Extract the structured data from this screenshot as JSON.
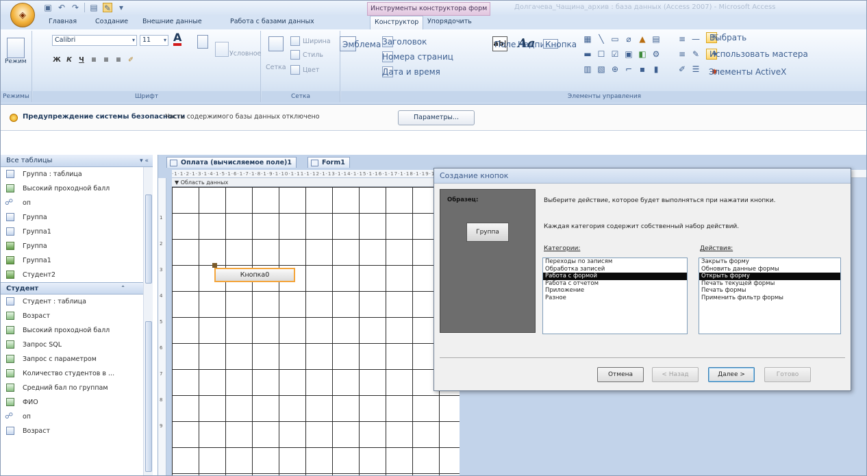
{
  "app": {
    "office_button": "",
    "context_title": "Инструменты конструктора форм",
    "window_title": "Долгачева_Чащина_архив : база данных (Access 2007) - Microsoft Access"
  },
  "ribbon_tabs": {
    "home": "Главная",
    "create": "Создание",
    "external": "Внешние данные",
    "db_tools": "Работа с базами данных",
    "design": "Конструктор",
    "arrange": "Упорядочить"
  },
  "ribbon": {
    "groups": {
      "views": "Режимы",
      "font": "Шрифт",
      "grid": "Сетка",
      "controls": "Элементы управления"
    },
    "views_btn": "Режим",
    "font_name": "Calibri",
    "font_size": "11",
    "conditional": "Условное",
    "gridlines": "Сетка",
    "width": "Ширина",
    "style": "Стиль",
    "color": "Цвет",
    "logo": "Эмблема",
    "title": "Заголовок",
    "page_numbers": "Номера страниц",
    "date_time": "Дата и время",
    "field": "Поле",
    "label": "Надпись",
    "button": "Кнопка",
    "select": "Выбрать",
    "use_wizards": "Использовать мастера",
    "activex": "Элементы ActiveX"
  },
  "security": {
    "title": "Предупреждение системы безопасности",
    "message": "Часть содержимого базы данных отключено",
    "options_button": "Параметры..."
  },
  "nav": {
    "header": "Все таблицы",
    "items_top": [
      {
        "label": "Группа : таблица",
        "type": "table"
      },
      {
        "label": "Высокий проходной балл",
        "type": "query"
      },
      {
        "label": "оп",
        "type": "key"
      },
      {
        "label": "Группа",
        "type": "table"
      },
      {
        "label": "Группа1",
        "type": "table"
      },
      {
        "label": "Группа",
        "type": "form"
      },
      {
        "label": "Группа1",
        "type": "form"
      },
      {
        "label": "Студент2",
        "type": "form"
      }
    ],
    "group2": "Студент",
    "items_bottom": [
      {
        "label": "Студент : таблица",
        "type": "table"
      },
      {
        "label": "Возраст",
        "type": "query"
      },
      {
        "label": "Высокий проходной балл",
        "type": "query"
      },
      {
        "label": "Запрос SQL",
        "type": "query"
      },
      {
        "label": "Запрос с параметром",
        "type": "query"
      },
      {
        "label": "Количество студентов в ...",
        "type": "query"
      },
      {
        "label": "Средний бал по группам",
        "type": "query"
      },
      {
        "label": "ФИО",
        "type": "query"
      },
      {
        "label": "оп",
        "type": "key"
      },
      {
        "label": "Возраст",
        "type": "table"
      }
    ]
  },
  "doc_tabs": {
    "tab1": "Оплата (вычисляемое поле)1",
    "tab2": "Form1"
  },
  "designer": {
    "ruler": "·1·1·2·1·3·1·4·1·5·1·6·1·7·1·8·1·9·1·10·1·11·1·12·1·13·1·14·1·15·1·16·1·17·1·18·1·19·1",
    "section": "Область данных",
    "button_control": "Кнопка0",
    "vruler": [
      "1",
      "2",
      "3",
      "4",
      "5",
      "6",
      "7",
      "8",
      "9"
    ]
  },
  "dialog": {
    "title": "Создание кнопок",
    "sample_label": "Образец:",
    "sample_button": "Группа",
    "instruction": "Выберите действие, которое будет выполняться при нажатии кнопки.",
    "category_note": "Каждая категория содержит собственный набор действий.",
    "categories_label": "Категории:",
    "actions_label": "Действия:",
    "categories": [
      "Переходы по записям",
      "Обработка записей",
      "Работа с формой",
      "Работа с отчетом",
      "Приложение",
      "Разное"
    ],
    "actions": [
      "Закрыть форму",
      "Обновить данные формы",
      "Открыть форму",
      "Печать текущей формы",
      "Печать формы",
      "Применить фильтр формы"
    ],
    "cancel": "Отмена",
    "back": "< Назад",
    "next": "Далее >",
    "finish": "Готово"
  }
}
